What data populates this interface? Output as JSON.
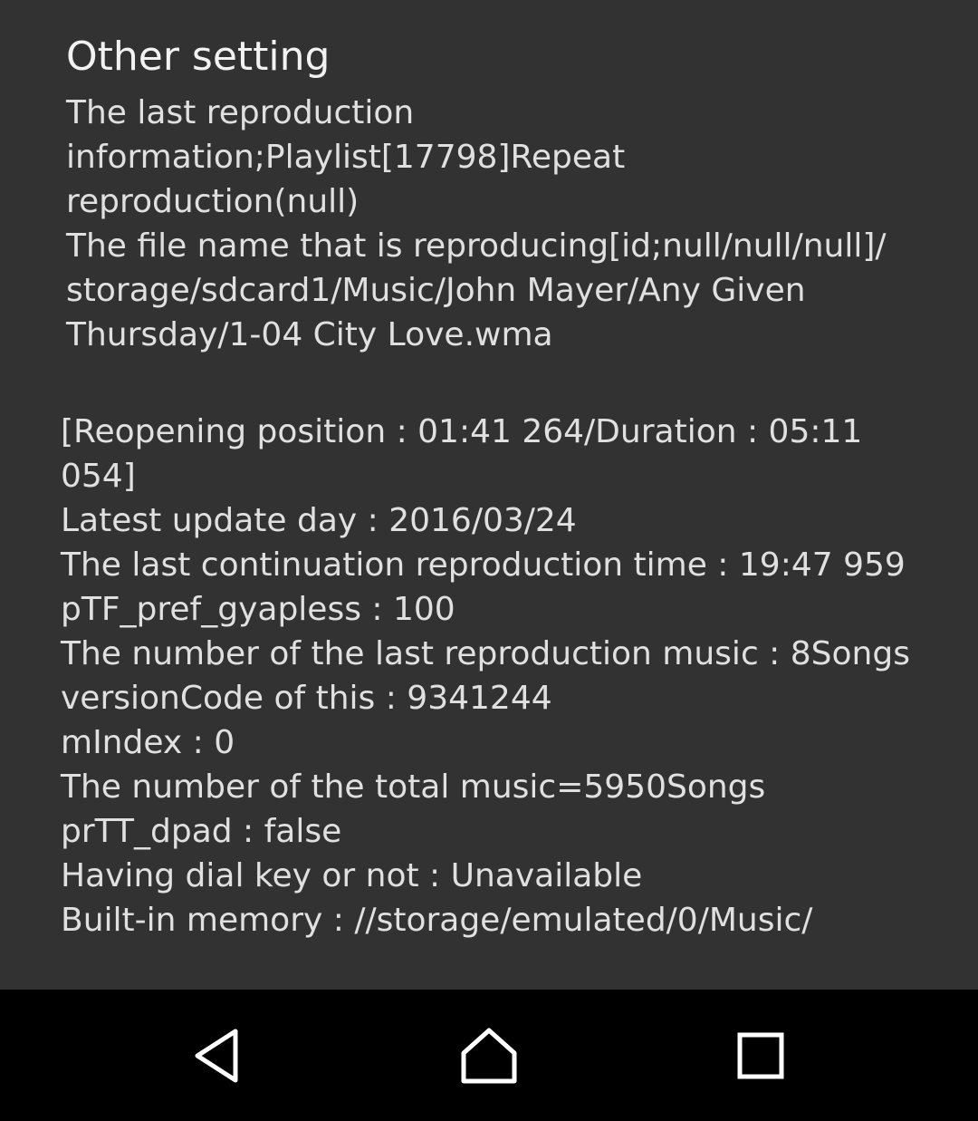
{
  "dialog": {
    "title": "Other setting",
    "info_lines": [
      "The last reproduction",
      "information;Playlist[17798]Repeat",
      "reproduction(null)",
      "The file name that is reproducing[id;null/null/null]/",
      "storage/sdcard1/Music/John Mayer/Any Given",
      "Thursday/1-04 City Love.wma"
    ],
    "stats_lines": [
      "[Reopening position : 01:41 264/Duration : 05:11",
      "054]",
      "Latest update day : 2016/03/24",
      "The last continuation reproduction time : 19:47 959",
      "pTF_pref_gyapless : 100",
      "The number of the last reproduction music : 8Songs",
      "versionCode of this : 9341244",
      "mIndex : 0",
      "The number of the total music=5950Songs",
      "prTT_dpad : false",
      "Having dial key or not : Unavailable",
      "Built-in memory : //storage/emulated/0/Music/"
    ]
  },
  "navbar": {
    "back_icon": "back-triangle-icon",
    "home_icon": "home-icon",
    "recents_icon": "recents-square-icon",
    "icon_color": "#ffffff",
    "background": "#000000"
  }
}
